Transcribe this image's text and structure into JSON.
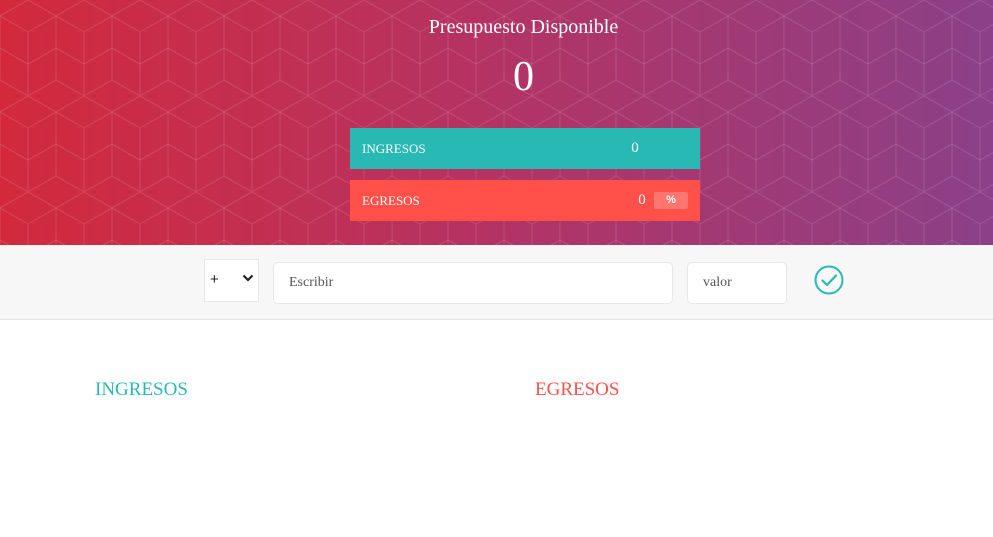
{
  "header": {
    "title": "Presupuesto Disponible",
    "budget_value": "0"
  },
  "summary": {
    "income": {
      "label": "INGRESOS",
      "value": "0",
      "color": "#28b9b5"
    },
    "expense": {
      "label": "EGRESOS",
      "value": "0",
      "percentage": "%",
      "color": "#ff5049"
    }
  },
  "add_form": {
    "type_selected": "+",
    "description_placeholder": "Escribir",
    "value_placeholder": "valor",
    "submit_icon": "check-circle-icon"
  },
  "lists": {
    "income_title": "INGRESOS",
    "expense_title": "EGRESOS"
  },
  "colors": {
    "gradient_start": "#d22a3c",
    "gradient_end": "#8b4088",
    "income": "#28b9b5",
    "expense": "#ff5049"
  }
}
